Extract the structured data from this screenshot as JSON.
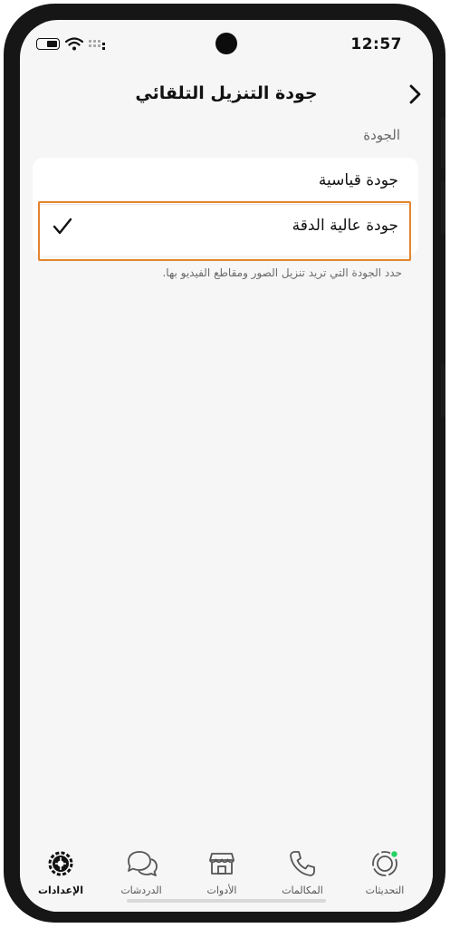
{
  "status_bar": {
    "time": "12:57"
  },
  "header": {
    "title": "جودة التنزيل التلقائي"
  },
  "section": {
    "label": "الجودة"
  },
  "options": [
    {
      "label": "جودة قياسية",
      "selected": false
    },
    {
      "label": "جودة عالية الدقة",
      "selected": true
    }
  ],
  "helper_text": "حدد الجودة التي تريد تنزيل الصور ومقاطع الفيديو بها.",
  "tabs": [
    {
      "label": "الإعدادات",
      "icon": "settings-gear-icon",
      "active": true
    },
    {
      "label": "الدردشات",
      "icon": "chat-bubbles-icon",
      "active": false
    },
    {
      "label": "الأدوات",
      "icon": "storefront-icon",
      "active": false
    },
    {
      "label": "المكالمات",
      "icon": "phone-icon",
      "active": false
    },
    {
      "label": "التحديثات",
      "icon": "status-updates-icon",
      "active": false
    }
  ],
  "colors": {
    "highlight": "#e4842e",
    "update_dot": "#25d366"
  }
}
